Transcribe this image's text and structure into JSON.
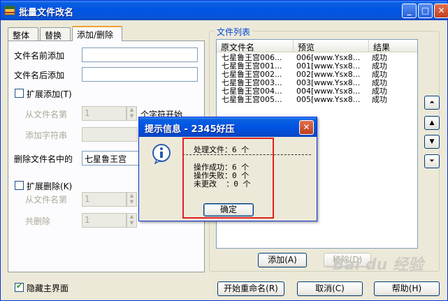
{
  "window": {
    "title": "批量文件改名",
    "min_glyph": "_",
    "max_glyph": "□",
    "close_glyph": "✕"
  },
  "tabs": [
    {
      "label": "整体"
    },
    {
      "label": "替换"
    },
    {
      "label": "添加/删除"
    }
  ],
  "panel": {
    "prefix_label": "文件名前添加",
    "prefix_value": "",
    "suffix_label": "文件名后添加",
    "suffix_value": "",
    "ext_add_label": "扩展添加(T)",
    "from_pos_label": "从文件名第",
    "from_pos_value": "1",
    "char_start_label": "个字符开始",
    "add_string_label": "添加字符串",
    "add_string_value": "",
    "delete_in_name_label": "删除文件名中的",
    "delete_in_name_value": "七星鲁王宫",
    "ext_delete_label": "扩展删除(K)",
    "del_from_label": "从文件名第",
    "del_from_value": "1",
    "del_total_label": "共删除",
    "del_total_value": "1"
  },
  "file_list": {
    "group_title": "文件列表",
    "columns": [
      "原文件名",
      "预览",
      "结果"
    ],
    "rows": [
      [
        "七星鲁王宫006...",
        "006[www.Ysx8...",
        "成功"
      ],
      [
        "七星鲁王宫001...",
        "001[www.Ysx8...",
        "成功"
      ],
      [
        "七星鲁王宫002...",
        "002[www.Ysx8...",
        "成功"
      ],
      [
        "七星鲁王宫003...",
        "003[www.Ysx8...",
        "成功"
      ],
      [
        "七星鲁王宫004...",
        "004[www.Ysx8...",
        "成功"
      ],
      [
        "七星鲁王宫005...",
        "005[www.Ysx8...",
        "成功"
      ]
    ],
    "add_button": "添加(A)",
    "remove_button": "移除(D)",
    "side_buttons": [
      "⏶",
      "▲",
      "▼",
      "⏷"
    ]
  },
  "bottom": {
    "hide_main_label": "隐藏主界面",
    "hide_main_checked": true,
    "start_rename": "开始重命名(R)",
    "cancel": "取消(C)",
    "help": "帮助(H)"
  },
  "dialog": {
    "title": "提示信息 - 2345好压",
    "processed_line": "处理文件：6 个",
    "success_line": "操作成功：6 个",
    "fail_line": "操作失败：0 个",
    "unchanged_line": "未更改  ：0 个",
    "ok_button": "确定",
    "close_glyph": "✕"
  },
  "watermark": "Bai du 经验"
}
